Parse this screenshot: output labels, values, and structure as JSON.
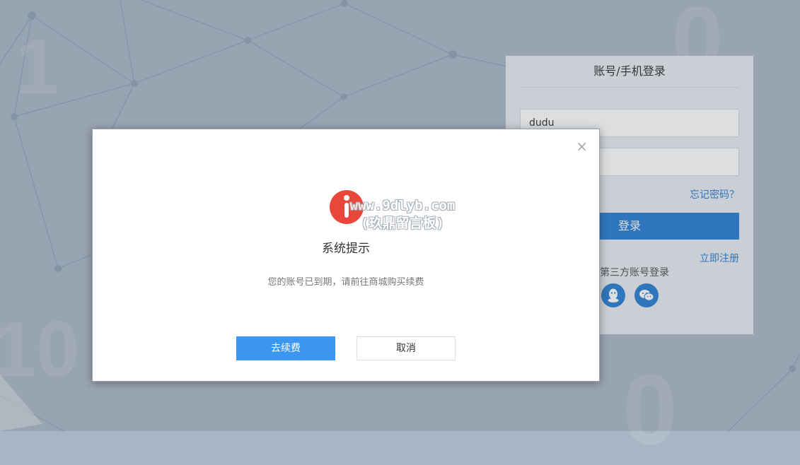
{
  "login": {
    "title": "账号/手机登录",
    "username_value": "dudu",
    "password_value": "",
    "forgot_label": "忘记密码？",
    "login_label": "登录",
    "register_label": "立即注册",
    "third_party_label": "用第三方账号登录",
    "social_icons": [
      "qq-icon",
      "wechat-icon"
    ]
  },
  "background": {
    "digits": [
      "1",
      "0",
      "10",
      "0"
    ]
  },
  "dialog": {
    "close_label": "×",
    "title": "系统提示",
    "message": "您的账号已到期，请前往商城购买续费",
    "watermark_line1": "www.9dlyb.com",
    "watermark_line2": "(玖鼎留言板)",
    "confirm_label": "去续费",
    "cancel_label": "取消",
    "icon": "info-icon"
  },
  "colors": {
    "accent": "#3a96f0",
    "login_button": "#2c80d3",
    "info_icon": "#e8473a",
    "link": "#2f7fd0"
  }
}
